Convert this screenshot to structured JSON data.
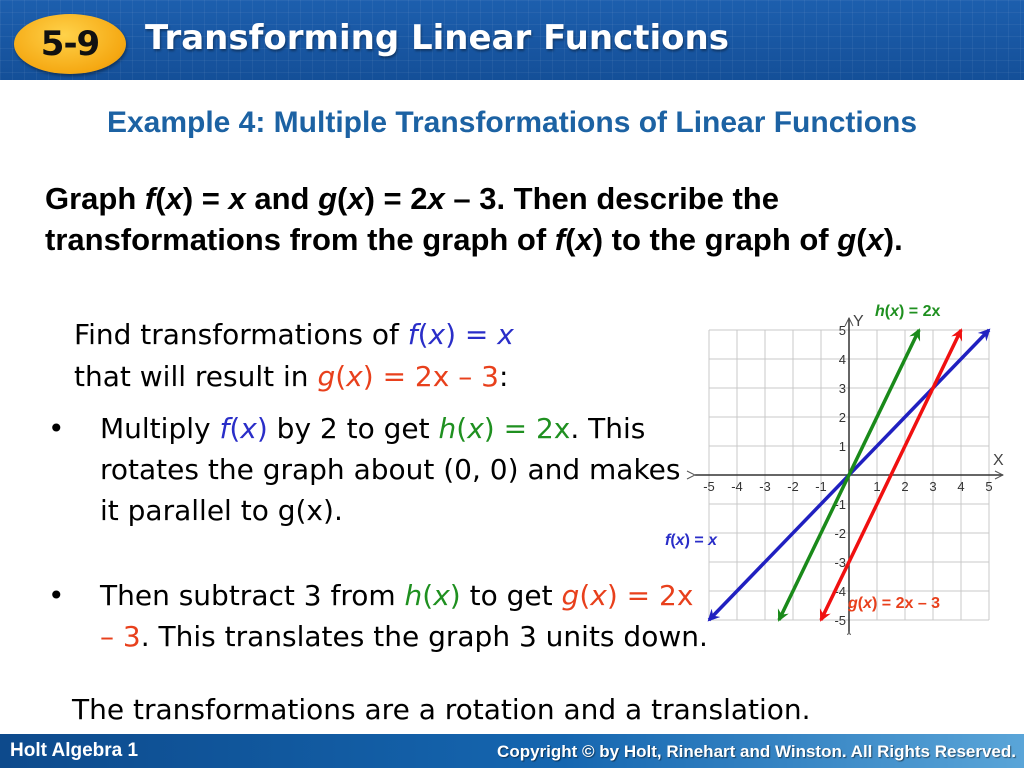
{
  "header": {
    "lesson_number": "5-9",
    "title": "Transforming Linear Functions"
  },
  "example_title": "Example 4: Multiple Transformations of  Linear Functions",
  "problem": {
    "p1": "Graph ",
    "f": "f",
    "x": "x",
    "p2": " = ",
    "p3": " and ",
    "g": "g",
    "p4": " = 2",
    "p5": " – 3. Then describe the transformations from the graph of ",
    "p6": " to the graph of ",
    "p7": "."
  },
  "find": {
    "t1": "Find transformations of ",
    "fx": "f(x) = x",
    "t2": "that will result in ",
    "gx": "g(x) = 2x – 3",
    "t3": ":"
  },
  "bullets": [
    {
      "t1": "Multiply ",
      "fx": "f(x)",
      "t2": " by 2 to get ",
      "hx": "h(x) = 2x",
      "t3": ". This rotates the graph about (0, 0) and makes it parallel to ",
      "gx": "g(x)",
      "t4": "."
    },
    {
      "t1": "Then subtract 3 from ",
      "hx": "h(x)",
      "t2": " to get ",
      "gx": "g(x) = 2x – 3",
      "t3": ". This translates the graph 3 units down."
    }
  ],
  "conclusion": "The transformations are a rotation and a translation.",
  "footer": {
    "left": "Holt Algebra 1",
    "right": "Copyright © by Holt, Rinehart and Winston. All Rights Reserved."
  },
  "colors": {
    "header_blue": "#1b5aa6",
    "title_blue": "#1c62a3",
    "f_blue": "#2a2ec8",
    "g_red": "#e8401c",
    "h_green": "#1f9020"
  },
  "chart_data": {
    "type": "line",
    "title": "",
    "xlabel": "X",
    "ylabel": "Y",
    "xlim": [
      -5,
      5
    ],
    "ylim": [
      -5,
      5
    ],
    "grid": true,
    "x_ticks": [
      "-5",
      "-4",
      "-3",
      "-2",
      "-1",
      "1",
      "2",
      "3",
      "4",
      "5"
    ],
    "y_ticks": [
      "5",
      "4",
      "3",
      "2",
      "1",
      "-1",
      "-2",
      "-3",
      "-4",
      "-5"
    ],
    "series": [
      {
        "name": "f(x) = x",
        "label": "f(x) = x",
        "slope": 1,
        "intercept": 0,
        "color": "#2020c0",
        "x_range": [
          -5,
          5
        ]
      },
      {
        "name": "h(x) = 2x",
        "label": "h(x) = 2x",
        "slope": 2,
        "intercept": 0,
        "color": "#1a8a1a",
        "x_range": [
          -2.5,
          2.5
        ]
      },
      {
        "name": "g(x) = 2x – 3",
        "label": "g(x) = 2x – 3",
        "slope": 2,
        "intercept": -3,
        "color": "#f01010",
        "x_range": [
          -1,
          4
        ]
      }
    ]
  }
}
